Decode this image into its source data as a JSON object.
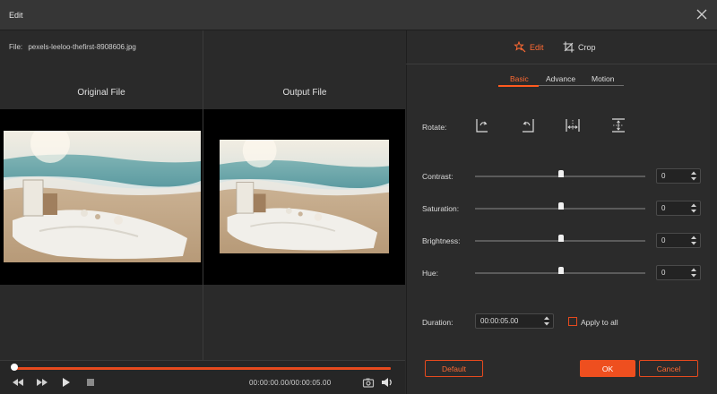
{
  "window": {
    "title": "Edit"
  },
  "file": {
    "label": "File:",
    "name": "pexels-leeloo-thefirst-8908606.jpg"
  },
  "panes": {
    "original": "Original File",
    "output": "Output File"
  },
  "player": {
    "timecode": "00:00:00.00/00:00:05.00",
    "progress": 0
  },
  "tabs": {
    "edit": "Edit",
    "crop": "Crop",
    "active": "Edit"
  },
  "subtabs": {
    "basic": "Basic",
    "advance": "Advance",
    "motion": "Motion",
    "active": "Basic"
  },
  "rotate": {
    "label": "Rotate:"
  },
  "adjust": [
    {
      "label": "Contrast:",
      "value": "0"
    },
    {
      "label": "Saturation:",
      "value": "0"
    },
    {
      "label": "Brightness:",
      "value": "0"
    },
    {
      "label": "Hue:",
      "value": "0"
    }
  ],
  "duration": {
    "label": "Duration:",
    "value": "00:00:05.00"
  },
  "apply_all": {
    "label": "Apply to all",
    "checked": false
  },
  "buttons": {
    "default": "Default",
    "ok": "OK",
    "cancel": "Cancel"
  },
  "colors": {
    "accent": "#ee4f1f",
    "background": "#2b2b2b",
    "titlebar": "#363636"
  }
}
